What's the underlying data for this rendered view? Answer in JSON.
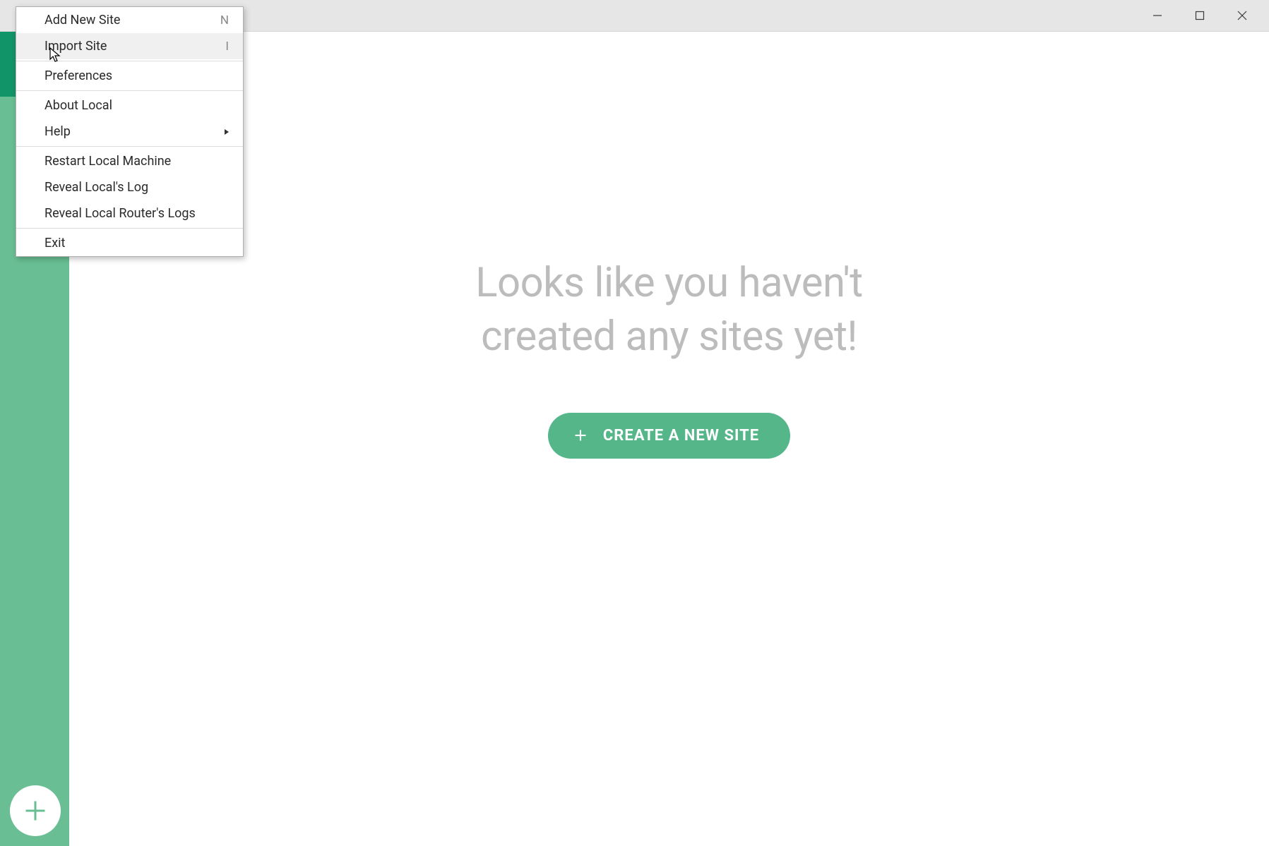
{
  "colors": {
    "accent": "#54b689",
    "sidebar": "#69bf93",
    "sidebar_dark": "#129469",
    "muted_text": "#bcbcbc"
  },
  "menu": {
    "items": [
      {
        "label": "Add New Site",
        "shortcut": "N",
        "has_submenu": false,
        "hovered": false
      },
      {
        "label": "Import Site",
        "shortcut": "I",
        "has_submenu": false,
        "hovered": true
      }
    ],
    "group2": [
      {
        "label": "Preferences",
        "shortcut": "",
        "has_submenu": false
      }
    ],
    "group3": [
      {
        "label": "About Local",
        "shortcut": "",
        "has_submenu": false
      },
      {
        "label": "Help",
        "shortcut": "",
        "has_submenu": true
      }
    ],
    "group4": [
      {
        "label": "Restart Local Machine",
        "shortcut": "",
        "has_submenu": false
      },
      {
        "label": "Reveal Local's Log",
        "shortcut": "",
        "has_submenu": false
      },
      {
        "label": "Reveal Local Router's Logs",
        "shortcut": "",
        "has_submenu": false
      }
    ],
    "group5": [
      {
        "label": "Exit",
        "shortcut": "",
        "has_submenu": false
      }
    ]
  },
  "empty": {
    "heading_line1": "Looks like you haven't",
    "heading_line2": "created any sites yet!"
  },
  "cta": {
    "label": "CREATE A NEW SITE"
  }
}
